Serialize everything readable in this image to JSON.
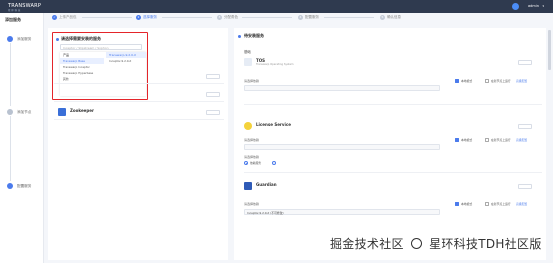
{
  "header": {
    "logo": "TRANSWARP",
    "logo_sub": "星 环 科 技",
    "user": "admin"
  },
  "sidebar": {
    "title": "添加服务",
    "steps": [
      {
        "label": "添加服务"
      },
      {
        "label": "添加节点"
      },
      {
        "label": "配置服务"
      }
    ]
  },
  "stepper": {
    "steps": [
      {
        "label": "上传产品包",
        "num": "1"
      },
      {
        "label": "选择服务",
        "num": "2"
      },
      {
        "label": "分配角色",
        "num": "3"
      },
      {
        "label": "配置服务",
        "num": "4"
      },
      {
        "label": "确认信息",
        "num": "5"
      }
    ]
  },
  "left_panel": {
    "title": "请选择需要安装的服务",
    "search_placeholder": "Inceptor / Slipstream / Sophon",
    "dropdown": {
      "col1_head": "产品",
      "col1_items": [
        "Transwarp Base",
        "Transwarp Inceptor",
        "Transwarp Hyperbase",
        "其他"
      ],
      "col2_head": "Transwarp-9.2.0-X",
      "col2_items": [
        "Inceptor-9.2.0-X"
      ]
    },
    "services": [
      {
        "name": "Zookeeper",
        "desc": ""
      }
    ]
  },
  "right_panel": {
    "title": "待安装服务",
    "base_tag": "基础",
    "services": [
      {
        "name": "TOS",
        "desc": "Transwarp Operating System",
        "label": "请选择依赖",
        "checkbox_1": "本地模式",
        "checkbox_2": "在新节点上运行",
        "link": "高级配置"
      },
      {
        "name": "License Service",
        "desc": "",
        "label": "请选择依赖",
        "radio_label": "依赖服务",
        "radio_2": "",
        "checkbox_1": "本地模式",
        "checkbox_2": "在新节点上运行",
        "link": "高级配置"
      },
      {
        "name": "Guardian",
        "desc": "",
        "label": "请选择依赖",
        "select_value": "Inceptor-9.2.0-X (不可修改)",
        "checkbox_1": "本地模式",
        "checkbox_2": "在新节点上运行",
        "link": "高级配置"
      }
    ]
  },
  "watermark": {
    "text_left": "掘金技术社区",
    "text_right": "星环科技TDH社区版"
  },
  "colors": {
    "header_bg": "#2f3a4f",
    "accent": "#4b7bec",
    "highlight": "#e4252a"
  }
}
